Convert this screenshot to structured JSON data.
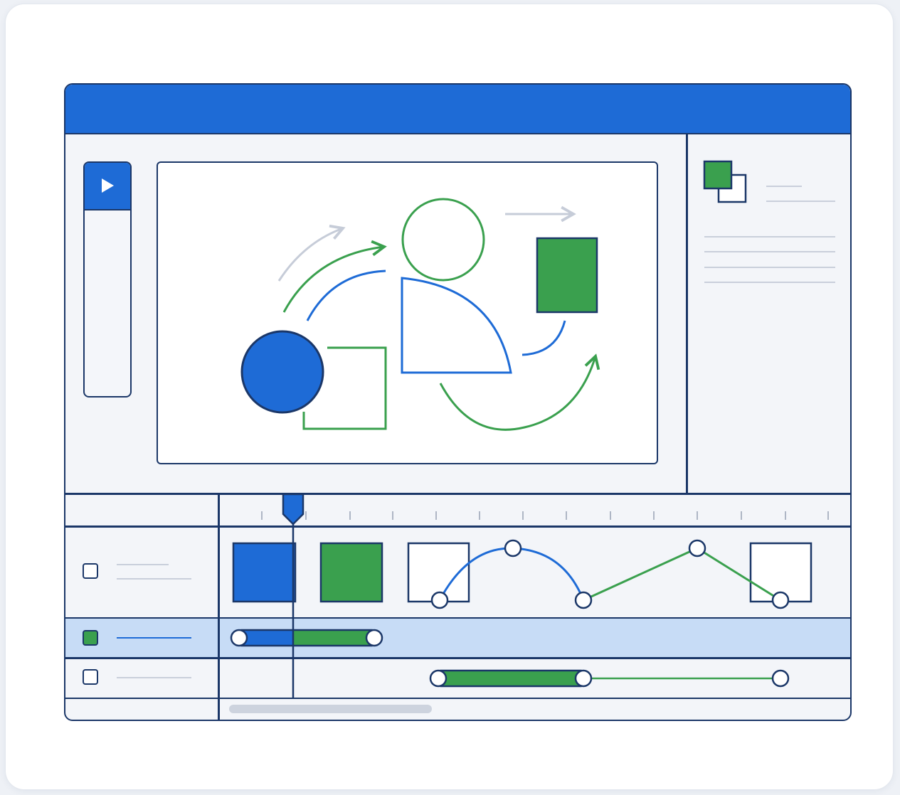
{
  "colors": {
    "accent": "#1e6bd6",
    "outline": "#1b3768",
    "green": "#3aa04e",
    "highlight_row": "#c7dcf6",
    "muted": "#c9cfdb"
  },
  "icons": {
    "play": "play-icon",
    "layers": "layers-icon"
  },
  "timeline": {
    "tracks": [
      {
        "name": "track-1",
        "checked": false,
        "selected": false
      },
      {
        "name": "track-2",
        "checked": true,
        "selected": true
      },
      {
        "name": "track-3",
        "checked": false,
        "selected": false
      }
    ]
  }
}
